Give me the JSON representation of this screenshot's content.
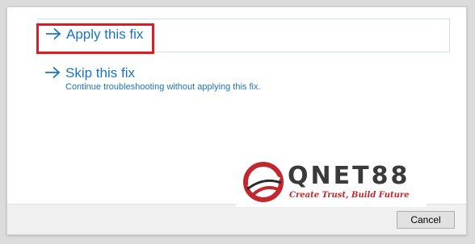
{
  "dialog": {
    "options": [
      {
        "title": "Apply this fix",
        "description": ""
      },
      {
        "title": "Skip this fix",
        "description": "Continue troubleshooting without applying this fix."
      }
    ],
    "cancel_label": "Cancel"
  },
  "watermark": {
    "brand": "QNET88",
    "tagline": "Create Trust, Build Future"
  },
  "colors": {
    "link_blue": "#1a73c6",
    "highlight_red": "#e01b22",
    "footer_gray": "#f0f0f0"
  }
}
